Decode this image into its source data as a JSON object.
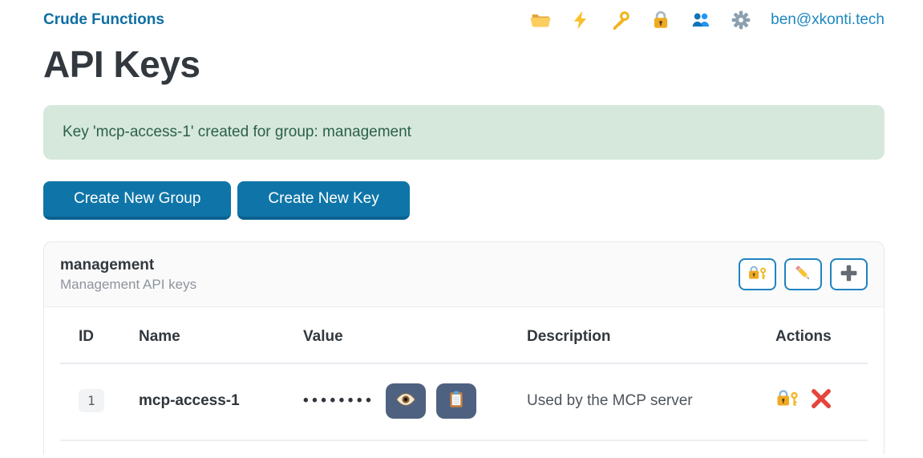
{
  "navbar": {
    "brand": "Crude Functions",
    "user_email": "ben@xkonti.tech",
    "icons": [
      "folder-icon",
      "lightning-icon",
      "key-icon",
      "lock-icon",
      "users-icon",
      "gear-icon"
    ]
  },
  "page": {
    "title": "API Keys"
  },
  "alert": {
    "message": "Key 'mcp-access-1' created for group: management"
  },
  "toolbar": {
    "create_group_label": "Create New Group",
    "create_key_label": "Create New Key"
  },
  "group_card": {
    "title": "management",
    "subtitle": "Management API keys",
    "action_icons": [
      "lock-with-key-icon",
      "pencil-icon",
      "plus-icon"
    ]
  },
  "table": {
    "headers": [
      "ID",
      "Name",
      "Value",
      "Description",
      "Actions"
    ],
    "rows": [
      {
        "id": "1",
        "name": "mcp-access-1",
        "value_masked": "••••••••",
        "description": "Used by the MCP server",
        "value_actions": [
          "eye-icon",
          "clipboard-icon"
        ],
        "row_actions": [
          "lock-with-key-icon",
          "delete-x-icon"
        ]
      }
    ]
  },
  "colors": {
    "brand_link": "#0e6fa3",
    "nav_link": "#1e87bf",
    "primary_button": "#0f75a8",
    "alert_bg": "#d6e8dc",
    "alert_text": "#2b6049",
    "value_button_bg": "#4e6180",
    "delete_x": "#e5453c"
  }
}
